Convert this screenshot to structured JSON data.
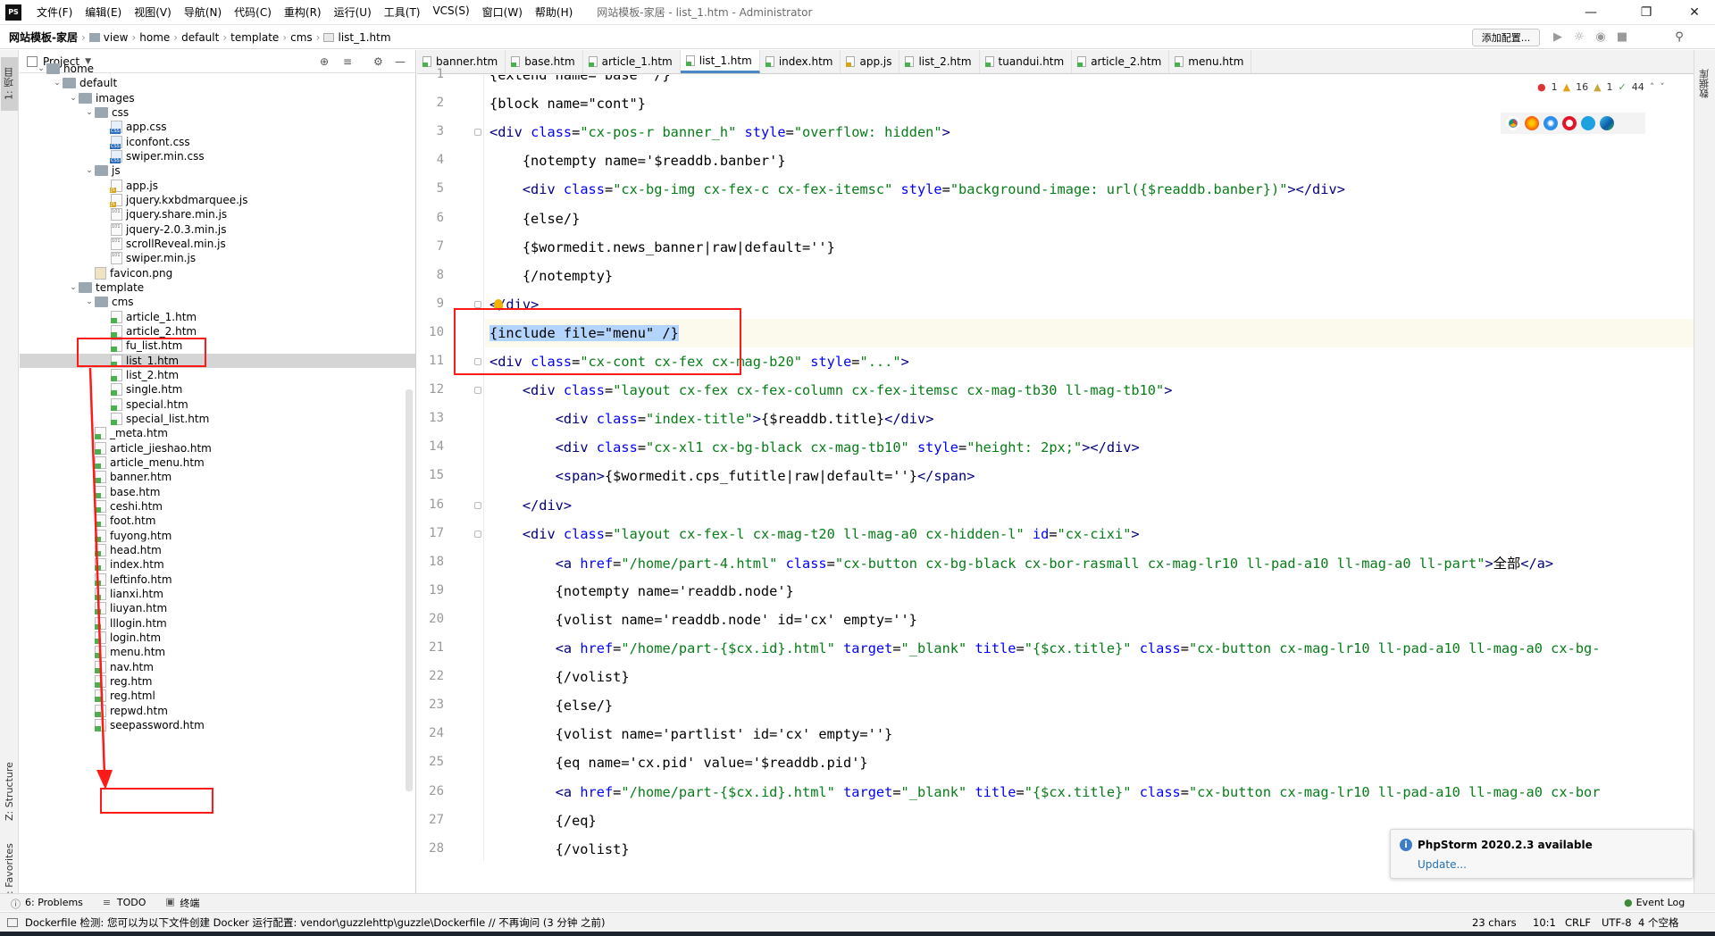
{
  "window": {
    "title": "网站模板-家居 - list_1.htm - Administrator",
    "menu": [
      "文件(F)",
      "编辑(E)",
      "视图(V)",
      "导航(N)",
      "代码(C)",
      "重构(R)",
      "运行(U)",
      "工具(T)",
      "VCS(S)",
      "窗口(W)",
      "帮助(H)"
    ],
    "app_icon_text": "PS"
  },
  "navbar": {
    "breadcrumbs": [
      "网站模板-家居",
      "view",
      "home",
      "default",
      "template",
      "cms",
      "list_1.htm"
    ],
    "run_config": "添加配置..."
  },
  "tool_strip": {
    "project_tab": "1: 项目",
    "structure_tab": "Z: Structure",
    "favorites_tab": "2: Favorites",
    "right_tab": "数据库"
  },
  "project": {
    "header": "Project",
    "tree": [
      {
        "label": "home",
        "kind": "folder",
        "depth": 1,
        "open": true
      },
      {
        "label": "default",
        "kind": "folder",
        "depth": 2,
        "open": true
      },
      {
        "label": "images",
        "kind": "folder",
        "depth": 3,
        "open": true
      },
      {
        "label": "css",
        "kind": "folder",
        "depth": 4,
        "open": true
      },
      {
        "label": "app.css",
        "kind": "css",
        "depth": 5
      },
      {
        "label": "iconfont.css",
        "kind": "css",
        "depth": 5
      },
      {
        "label": "swiper.min.css",
        "kind": "css",
        "depth": 5
      },
      {
        "label": "js",
        "kind": "folder",
        "depth": 4,
        "open": true
      },
      {
        "label": "app.js",
        "kind": "js",
        "depth": 5
      },
      {
        "label": "jquery.kxbdmarquee.js",
        "kind": "js",
        "depth": 5
      },
      {
        "label": "jquery.share.min.js",
        "kind": "min",
        "depth": 5
      },
      {
        "label": "jquery-2.0.3.min.js",
        "kind": "min",
        "depth": 5
      },
      {
        "label": "scrollReveal.min.js",
        "kind": "min",
        "depth": 5
      },
      {
        "label": "swiper.min.js",
        "kind": "min",
        "depth": 5
      },
      {
        "label": "favicon.png",
        "kind": "png",
        "depth": 4
      },
      {
        "label": "template",
        "kind": "folder",
        "depth": 3,
        "open": true
      },
      {
        "label": "cms",
        "kind": "folder",
        "depth": 4,
        "open": true
      },
      {
        "label": "article_1.htm",
        "kind": "htm",
        "depth": 5
      },
      {
        "label": "article_2.htm",
        "kind": "htm",
        "depth": 5
      },
      {
        "label": "fu_list.htm",
        "kind": "htm",
        "depth": 5
      },
      {
        "label": "list_1.htm",
        "kind": "htm",
        "depth": 5,
        "selected": true
      },
      {
        "label": "list_2.htm",
        "kind": "htm",
        "depth": 5
      },
      {
        "label": "single.htm",
        "kind": "htm",
        "depth": 5
      },
      {
        "label": "special.htm",
        "kind": "htm",
        "depth": 5
      },
      {
        "label": "special_list.htm",
        "kind": "htm",
        "depth": 5
      },
      {
        "label": "_meta.htm",
        "kind": "htm",
        "depth": 4
      },
      {
        "label": "article_jieshao.htm",
        "kind": "htm",
        "depth": 4
      },
      {
        "label": "article_menu.htm",
        "kind": "htm",
        "depth": 4
      },
      {
        "label": "banner.htm",
        "kind": "htm",
        "depth": 4
      },
      {
        "label": "base.htm",
        "kind": "htm",
        "depth": 4
      },
      {
        "label": "ceshi.htm",
        "kind": "htm",
        "depth": 4
      },
      {
        "label": "foot.htm",
        "kind": "htm",
        "depth": 4
      },
      {
        "label": "fuyong.htm",
        "kind": "htm",
        "depth": 4
      },
      {
        "label": "head.htm",
        "kind": "htm",
        "depth": 4
      },
      {
        "label": "index.htm",
        "kind": "htm",
        "depth": 4
      },
      {
        "label": "leftinfo.htm",
        "kind": "htm",
        "depth": 4
      },
      {
        "label": "lianxi.htm",
        "kind": "htm",
        "depth": 4
      },
      {
        "label": "liuyan.htm",
        "kind": "htm",
        "depth": 4
      },
      {
        "label": "lllogin.htm",
        "kind": "htm",
        "depth": 4
      },
      {
        "label": "login.htm",
        "kind": "htm",
        "depth": 4
      },
      {
        "label": "menu.htm",
        "kind": "htm",
        "depth": 4
      },
      {
        "label": "nav.htm",
        "kind": "htm",
        "depth": 4
      },
      {
        "label": "reg.htm",
        "kind": "htm",
        "depth": 4
      },
      {
        "label": "reg.html",
        "kind": "htm",
        "depth": 4
      },
      {
        "label": "repwd.htm",
        "kind": "htm",
        "depth": 4
      },
      {
        "label": "seepassword.htm",
        "kind": "htm",
        "depth": 4
      }
    ]
  },
  "tabs": [
    {
      "label": "banner.htm",
      "kind": "htm"
    },
    {
      "label": "base.htm",
      "kind": "htm"
    },
    {
      "label": "article_1.htm",
      "kind": "htm"
    },
    {
      "label": "list_1.htm",
      "kind": "htm",
      "active": true
    },
    {
      "label": "index.htm",
      "kind": "htm"
    },
    {
      "label": "app.js",
      "kind": "js"
    },
    {
      "label": "list_2.htm",
      "kind": "htm"
    },
    {
      "label": "tuandui.htm",
      "kind": "htm"
    },
    {
      "label": "article_2.htm",
      "kind": "htm"
    },
    {
      "label": "menu.htm",
      "kind": "htm"
    }
  ],
  "inspections": {
    "errors": "1",
    "warnings": "16",
    "weak": "1",
    "typos": "44"
  },
  "code_lines": [
    "{extend name=\"base\" /}",
    "{block name=\"cont\"}",
    "<div class=\"cx-pos-r banner_h\" style=\"overflow: hidden\">",
    "    {notempty name='$readdb.banber'}",
    "    <div class=\"cx-bg-img cx-fex-c cx-fex-itemsc\" style=\"background-image: url({$readdb.banber})\"></div>",
    "    {else/}",
    "    {$wormedit.news_banner|raw|default=''}",
    "    {/notempty}",
    "</div>",
    "{include file=\"menu\" /}",
    "<div class=\"cx-cont cx-fex cx-mag-b20\" style=\"...\">",
    "    <div class=\"layout cx-fex cx-fex-column cx-fex-itemsc cx-mag-tb30 ll-mag-tb10\">",
    "        <div class=\"index-title\">{$readdb.title}</div>",
    "        <div class=\"cx-xl1 cx-bg-black cx-mag-tb10\" style=\"height: 2px;\"></div>",
    "        <span>{$wormedit.cps_futitle|raw|default=''}</span>",
    "    </div>",
    "    <div class=\"layout cx-fex-l cx-mag-t20 ll-mag-a0 cx-hidden-l\" id=\"cx-cixi\">",
    "        <a href=\"/home/part-4.html\" class=\"cx-button cx-bg-black cx-bor-rasmall cx-mag-lr10 ll-pad-a10 ll-mag-a0 ll-part\">全部</a>",
    "        {notempty name='readdb.node'}",
    "        {volist name='readdb.node' id='cx' empty=''}",
    "        <a href=\"/home/part-{$cx.id}.html\" target=\"_blank\" title=\"{$cx.title}\" class=\"cx-button cx-mag-lr10 ll-pad-a10 ll-mag-a0 cx-bg-",
    "        {/volist}",
    "        {else/}",
    "        {volist name='partlist' id='cx' empty=''}",
    "        {eq name='cx.pid' value='$readdb.pid'}",
    "        <a href=\"/home/part-{$cx.id}.html\" target=\"_blank\" title=\"{$cx.title}\" class=\"cx-button cx-mag-lr10 ll-pad-a10 ll-mag-a0 cx-bor",
    "        {/eq}",
    "        {/volist}"
  ],
  "notification": {
    "title": "PhpStorm 2020.2.3 available",
    "link": "Update..."
  },
  "bottom_tabs": [
    "6: Problems",
    "TODO",
    "终端"
  ],
  "event_log": "Event Log",
  "status": {
    "message": "Dockerfile 检测: 您可以为以下文件创建 Docker 运行配置: vendor\\guzzlehttp\\guzzle\\Dockerfile // 不再询问 (3 分钟 之前)",
    "chars": "23 chars",
    "position": "10:1",
    "line_sep": "CRLF",
    "encoding": "UTF-8",
    "indent": "4 个空格"
  },
  "colors": {
    "accent": "#4a88c7",
    "annotation": "#ff1a1a",
    "selection": "#b3d4fd"
  }
}
